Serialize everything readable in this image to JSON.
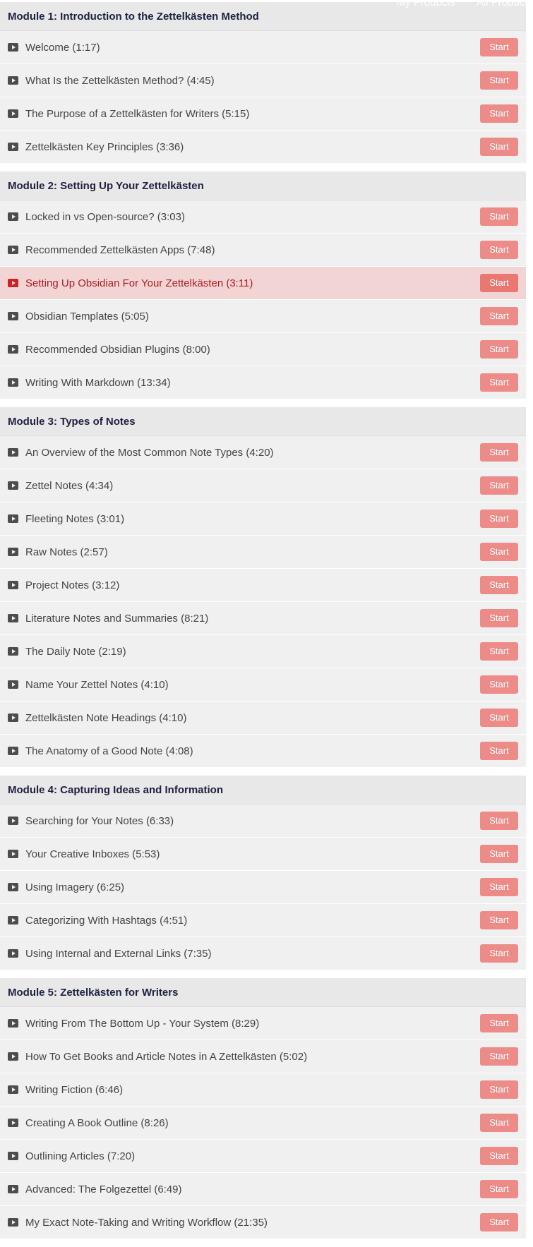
{
  "nav": {
    "items": [
      {
        "label": "My Products"
      },
      {
        "label": "All Products"
      }
    ]
  },
  "start_label": "Start",
  "colors": {
    "button": "#ec8b88",
    "current_row": "#f3d4d5",
    "current_text": "#b01e1e",
    "header_text": "#1e2040"
  },
  "modules": [
    {
      "title": "Module 1: Introduction to the Zettelkästen Method",
      "lectures": [
        {
          "title": "Welcome (1:17)"
        },
        {
          "title": "What Is the Zettelkästen Method? (4:45)"
        },
        {
          "title": "The Purpose of a Zettelkästen for Writers (5:15)"
        },
        {
          "title": "Zettelkästen Key Principles (3:36)"
        }
      ]
    },
    {
      "title": "Module 2: Setting Up Your Zettelkästen",
      "lectures": [
        {
          "title": "Locked in vs Open-source? (3:03)"
        },
        {
          "title": "Recommended Zettelkästen Apps (7:48)"
        },
        {
          "title": "Setting Up Obsidian For Your Zettelkästen (3:11)",
          "current": true
        },
        {
          "title": "Obsidian Templates (5:05)"
        },
        {
          "title": "Recommended Obsidian Plugins (8:00)"
        },
        {
          "title": "Writing With Markdown (13:34)"
        }
      ]
    },
    {
      "title": "Module 3: Types of Notes",
      "lectures": [
        {
          "title": "An Overview of the Most Common Note Types (4:20)"
        },
        {
          "title": "Zettel Notes (4:34)"
        },
        {
          "title": "Fleeting Notes (3:01)"
        },
        {
          "title": "Raw Notes (2:57)"
        },
        {
          "title": "Project Notes (3:12)"
        },
        {
          "title": "Literature Notes and Summaries (8:21)"
        },
        {
          "title": "The Daily Note (2:19)"
        },
        {
          "title": "Name Your Zettel Notes (4:10)"
        },
        {
          "title": "Zettelkästen Note Headings (4:10)"
        },
        {
          "title": "The Anatomy of a Good Note (4:08)"
        }
      ]
    },
    {
      "title": "Module 4: Capturing Ideas and Information",
      "lectures": [
        {
          "title": "Searching for Your Notes (6:33)"
        },
        {
          "title": "Your Creative Inboxes (5:53)"
        },
        {
          "title": "Using Imagery (6:25)"
        },
        {
          "title": "Categorizing With Hashtags (4:51)"
        },
        {
          "title": "Using Internal and External Links (7:35)"
        }
      ]
    },
    {
      "title": "Module 5: Zettelkästen for Writers",
      "lectures": [
        {
          "title": "Writing From The Bottom Up - Your System (8:29)"
        },
        {
          "title": "How To Get Books and Article Notes in A Zettelkästen (5:02)"
        },
        {
          "title": "Writing Fiction (6:46)"
        },
        {
          "title": "Creating A Book Outline (8:26)"
        },
        {
          "title": "Outlining Articles (7:20)"
        },
        {
          "title": "Advanced: The Folgezettel (6:49)"
        },
        {
          "title": "My Exact Note-Taking and Writing Workflow (21:35)"
        }
      ]
    }
  ]
}
